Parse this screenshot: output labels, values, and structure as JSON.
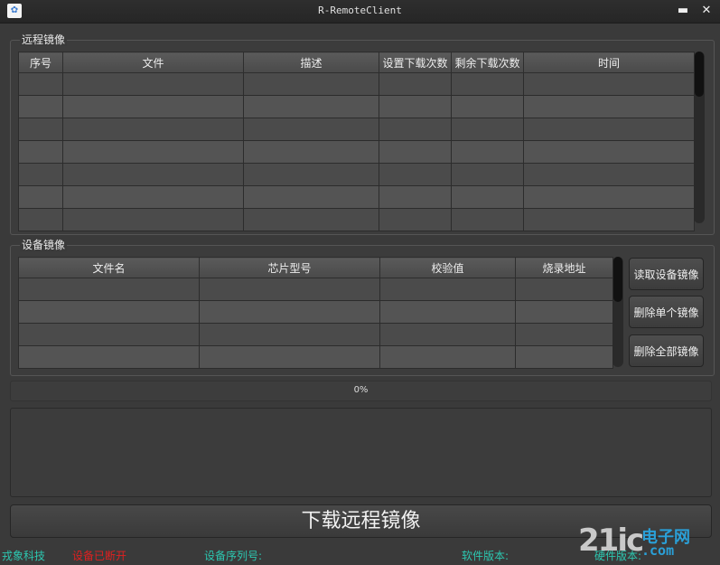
{
  "window": {
    "title": "R-RemoteClient",
    "icon": "app-logo-icon",
    "minimize_label": "▬",
    "close_label": "✕"
  },
  "remote": {
    "group_title": "远程镜像",
    "columns": [
      "序号",
      "文件",
      "描述",
      "设置下载次数",
      "剩余下载次数",
      "时间"
    ],
    "rows_visible": 7
  },
  "device": {
    "group_title": "设备镜像",
    "columns": [
      "文件名",
      "芯片型号",
      "校验值",
      "烧录地址"
    ],
    "rows_visible": 4,
    "read_button": "读取设备镜像",
    "delete_one_button": "删除单个镜像",
    "delete_all_button": "删除全部镜像"
  },
  "progress": {
    "value": 0,
    "text": "0%",
    "color": "#4d8fd6"
  },
  "download_button": "下载远程镜像",
  "statusbar": {
    "company": "戎象科技",
    "company_color": "#2cc7b0",
    "connection": "设备已断开",
    "connection_color": "#e02020",
    "serial_label": "设备序列号:",
    "software_label": "软件版本:",
    "hardware_label": "硬件版本:",
    "label_color": "#2cc7b0"
  },
  "watermark": {
    "main": "21ic",
    "cn": "电子网",
    "domain": ".com"
  }
}
